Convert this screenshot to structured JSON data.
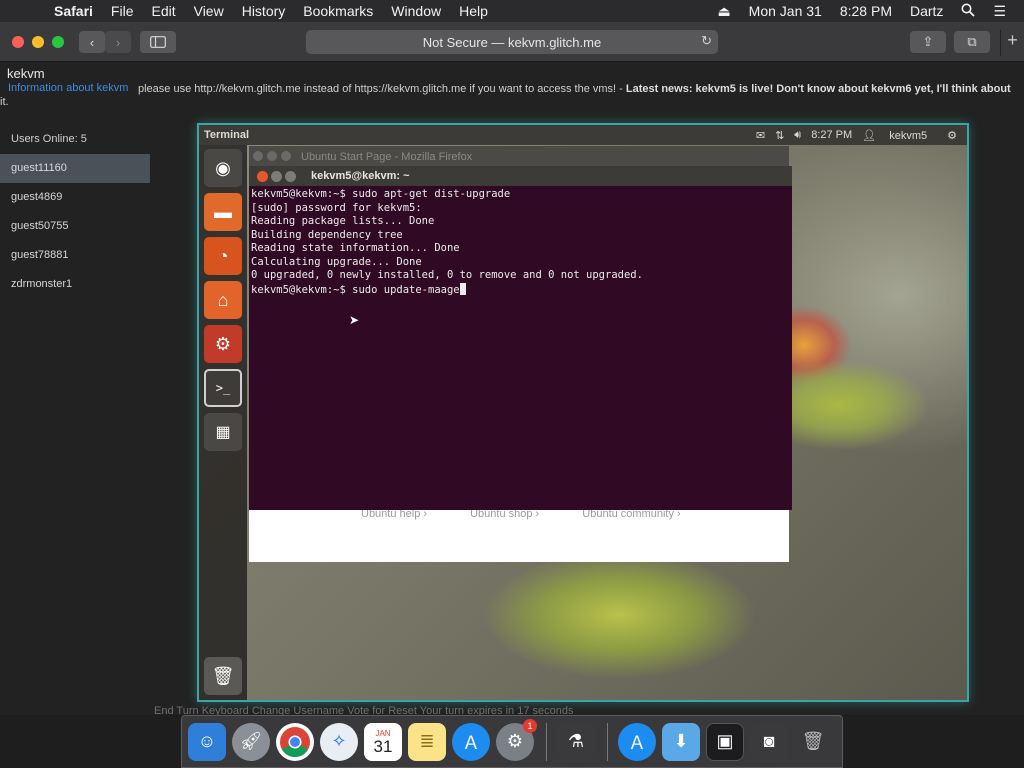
{
  "menubar": {
    "app_name": "Safari",
    "items": [
      "File",
      "Edit",
      "View",
      "History",
      "Bookmarks",
      "Window",
      "Help"
    ],
    "date": "Mon Jan 31",
    "time": "8:28 PM",
    "user": "Dartz"
  },
  "toolbar": {
    "url": "Not Secure — kekvm.glitch.me"
  },
  "site": {
    "title": "kekvm",
    "info_link": "Information about kekvm",
    "notice_plain": "please use http://kekvm.glitch.me instead of https://kekvm.glitch.me if you want to access the vms! - ",
    "notice_bold": "Latest news: kekvm5 is live! Don't know about kekvm6 yet, I'll think about",
    "notice_wrap": "it."
  },
  "users": {
    "count_label": "Users Online: 5",
    "list": [
      "guest11160",
      "guest4869",
      "guest50755",
      "guest78881",
      "zdrmonster1"
    ]
  },
  "vm": {
    "panel_title": "Terminal",
    "panel_time": "8:27 PM",
    "panel_user": "kekvm5",
    "firefox_title": "Ubuntu Start Page - Mozilla Firefox",
    "firefox_links": [
      "Ubuntu help ›",
      "Ubuntu shop ›",
      "Ubuntu community ›"
    ],
    "terminal_title": "kekvm5@kekvm: ~",
    "terminal_lines": [
      "kekvm5@kekvm:~$ sudo apt-get dist-upgrade",
      "[sudo] password for kekvm5:",
      "Reading package lists... Done",
      "Building dependency tree",
      "Reading state information... Done",
      "Calculating upgrade... Done",
      "0 upgraded, 0 newly installed, 0 to remove and 0 not upgraded."
    ],
    "prompt_line": "kekvm5@kekvm:~$ sudo update-maage"
  },
  "bottom": {
    "text": "End Turn    Keyboard    Change Username    Vote for Reset    Your turn expires in 17 seconds"
  },
  "dock": {
    "calendar_month": "JAN",
    "calendar_day": "31",
    "prefs_badge": "1"
  },
  "colors": {
    "terminal_bg": "#300a24",
    "vm_border": "#3aa5a5",
    "link": "#3b8ce0"
  }
}
